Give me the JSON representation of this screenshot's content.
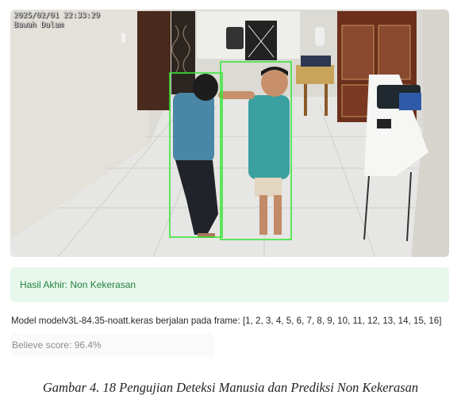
{
  "video": {
    "timestamp": "2025/02/01 22:33:29",
    "camera_name": "Bawah Dalam",
    "detection_box_color": "#39e639"
  },
  "result": {
    "label": "Hasil Akhir: Non Kekerasan",
    "accent_color": "#23813f",
    "background_color": "#e8f7ec"
  },
  "model_info": {
    "text": "Model modelv3L-84.35-noatt.keras berjalan pada frame: [1, 2, 3, 4, 5, 6, 7, 8, 9, 10, 11, 12, 13, 14, 15, 16]"
  },
  "score": {
    "text": "Believe score: 96.4%"
  },
  "caption": {
    "text": "Gambar 4. 18 Pengujian Deteksi Manusia dan Prediksi Non Kekerasan"
  }
}
